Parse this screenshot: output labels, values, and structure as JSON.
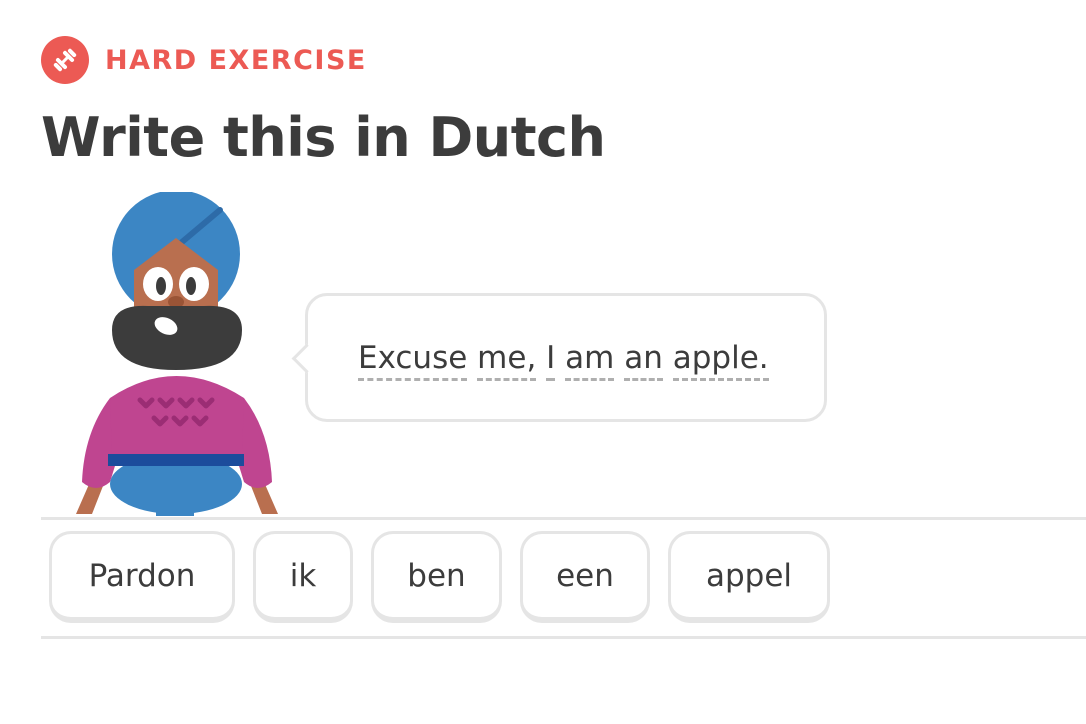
{
  "header": {
    "badge_icon": "dumbbell-icon",
    "badge_label": "HARD EXERCISE",
    "accent_color": "#ec5a54",
    "title": "Write this in Dutch"
  },
  "character": {
    "icon": "character-illustration"
  },
  "prompt": {
    "words": [
      "Excuse",
      "me,",
      "I",
      "am",
      "an",
      "apple."
    ],
    "spaces": [
      " ",
      " ",
      " ",
      " ",
      " "
    ]
  },
  "word_bank": {
    "words": [
      "Pardon",
      "ik",
      "ben",
      "een",
      "appel"
    ]
  }
}
